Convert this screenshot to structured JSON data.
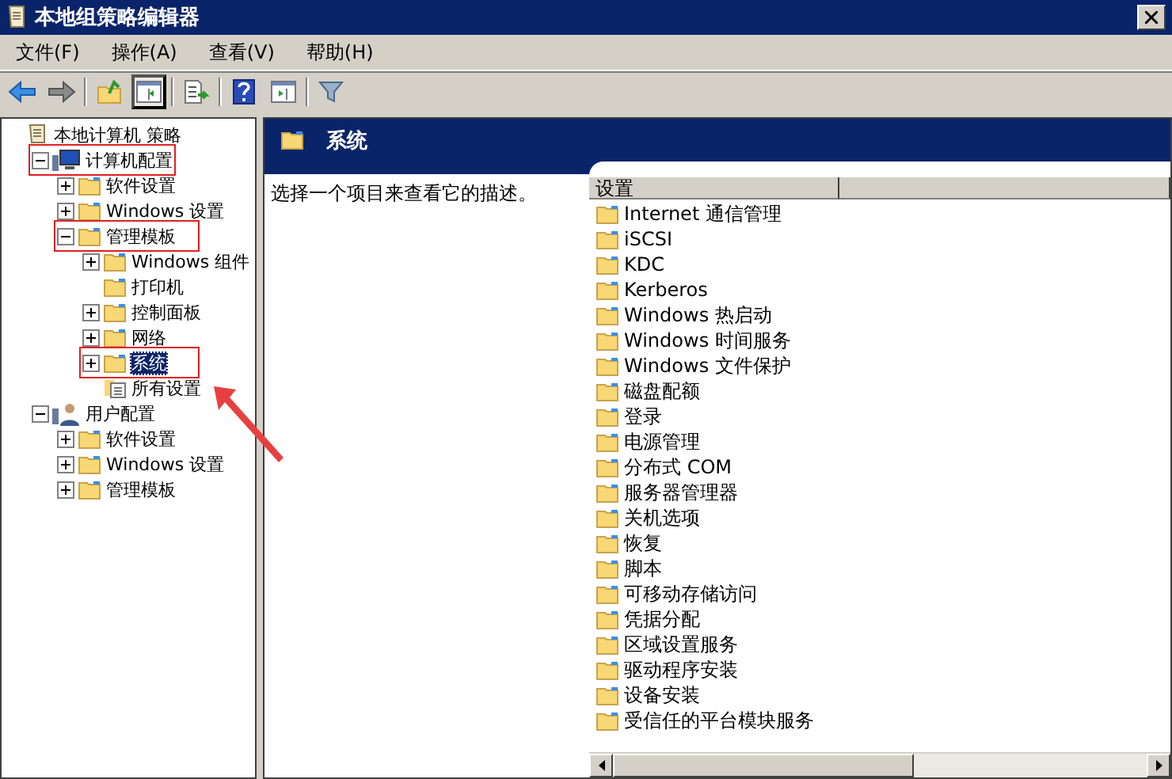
{
  "window": {
    "title": "本地组策略编辑器"
  },
  "menu": [
    "文件(F)",
    "操作(A)",
    "查看(V)",
    "帮助(H)"
  ],
  "toolbar": [
    {
      "kind": "back",
      "pressed": false
    },
    {
      "kind": "forward",
      "pressed": false
    },
    {
      "kind": "sep"
    },
    {
      "kind": "up",
      "pressed": false
    },
    {
      "kind": "tree-toggle",
      "pressed": true
    },
    {
      "kind": "sep"
    },
    {
      "kind": "export",
      "pressed": false
    },
    {
      "kind": "sep"
    },
    {
      "kind": "help",
      "pressed": false
    },
    {
      "kind": "pane-toggle",
      "pressed": false
    },
    {
      "kind": "sep"
    },
    {
      "kind": "filter",
      "pressed": false
    }
  ],
  "tree": [
    {
      "label": "本地计算机 策略",
      "kind": "policy",
      "selected": false,
      "highlighted": false,
      "children": [
        {
          "label": "计算机配置",
          "kind": "computer",
          "expanded": true,
          "selected": false,
          "highlighted": true,
          "children": [
            {
              "label": "软件设置",
              "kind": "folder",
              "expanded": false,
              "selected": false,
              "highlighted": false
            },
            {
              "label": "Windows 设置",
              "kind": "folder",
              "expanded": false,
              "selected": false,
              "highlighted": false
            },
            {
              "label": "管理模板",
              "kind": "folder",
              "expanded": true,
              "selected": false,
              "highlighted": true,
              "children": [
                {
                  "label": "Windows 组件",
                  "kind": "folder",
                  "expanded": false,
                  "selected": false,
                  "highlighted": false
                },
                {
                  "label": "打印机",
                  "kind": "folder",
                  "selected": false,
                  "highlighted": false
                },
                {
                  "label": "控制面板",
                  "kind": "folder",
                  "expanded": false,
                  "selected": false,
                  "highlighted": false
                },
                {
                  "label": "网络",
                  "kind": "folder",
                  "expanded": false,
                  "selected": false,
                  "highlighted": false
                },
                {
                  "label": "系统",
                  "kind": "folder",
                  "expanded": false,
                  "selected": true,
                  "highlighted": true
                },
                {
                  "label": "所有设置",
                  "kind": "settings",
                  "selected": false,
                  "highlighted": false,
                  "arrow": true
                }
              ]
            }
          ]
        },
        {
          "label": "用户配置",
          "kind": "user",
          "expanded": true,
          "selected": false,
          "highlighted": false,
          "children": [
            {
              "label": "软件设置",
              "kind": "folder",
              "expanded": false,
              "selected": false,
              "highlighted": false
            },
            {
              "label": "Windows 设置",
              "kind": "folder",
              "expanded": false,
              "selected": false,
              "highlighted": false
            },
            {
              "label": "管理模板",
              "kind": "folder",
              "expanded": false,
              "selected": false,
              "highlighted": false
            }
          ]
        }
      ]
    }
  ],
  "details": {
    "title": "系统",
    "description": "选择一个项目来查看它的描述。",
    "column": "设置",
    "items": [
      "Internet 通信管理",
      "iSCSI",
      "KDC",
      "Kerberos",
      "Windows 热启动",
      "Windows 时间服务",
      "Windows 文件保护",
      "磁盘配额",
      "登录",
      "电源管理",
      "分布式 COM",
      "服务器管理器",
      "关机选项",
      "恢复",
      "脚本",
      "可移动存储访问",
      "凭据分配",
      "区域设置服务",
      "驱动程序安装",
      "设备安装",
      "受信任的平台模块服务"
    ]
  }
}
